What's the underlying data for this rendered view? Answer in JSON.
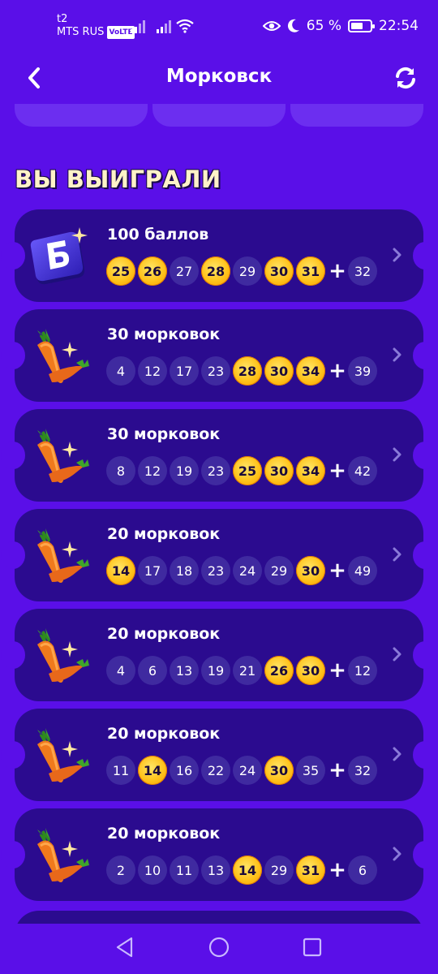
{
  "status_bar": {
    "operator_line1": "t2",
    "operator_line2": "MTS RUS",
    "volte": "VoLTE",
    "battery": "65 %",
    "battery_level": 0.65,
    "time": "22:54"
  },
  "header": {
    "title": "Морковск",
    "back_icon": "chevron-left-icon",
    "refresh_icon": "refresh-icon"
  },
  "section_title": "ВЫ ВЫИГРАЛИ",
  "cards": [
    {
      "prize": "100 баллов",
      "icon": "b-logo-icon",
      "numbers": [
        "25",
        "26",
        "27",
        "28",
        "29",
        "30",
        "31"
      ],
      "wins": [
        true,
        true,
        false,
        true,
        false,
        true,
        true
      ],
      "bonus": "32",
      "bonus_win": false
    },
    {
      "prize": "30 морковок",
      "icon": "carrot-icon",
      "numbers": [
        "4",
        "12",
        "17",
        "23",
        "28",
        "30",
        "34"
      ],
      "wins": [
        false,
        false,
        false,
        false,
        true,
        true,
        true
      ],
      "bonus": "39",
      "bonus_win": false
    },
    {
      "prize": "30 морковок",
      "icon": "carrot-icon",
      "numbers": [
        "8",
        "12",
        "19",
        "23",
        "25",
        "30",
        "34"
      ],
      "wins": [
        false,
        false,
        false,
        false,
        true,
        true,
        true
      ],
      "bonus": "42",
      "bonus_win": false
    },
    {
      "prize": "20 морковок",
      "icon": "carrot-icon",
      "numbers": [
        "14",
        "17",
        "18",
        "23",
        "24",
        "29",
        "30"
      ],
      "wins": [
        true,
        false,
        false,
        false,
        false,
        false,
        true
      ],
      "bonus": "49",
      "bonus_win": false
    },
    {
      "prize": "20 морковок",
      "icon": "carrot-icon",
      "numbers": [
        "4",
        "6",
        "13",
        "19",
        "21",
        "26",
        "30"
      ],
      "wins": [
        false,
        false,
        false,
        false,
        false,
        true,
        true
      ],
      "bonus": "12",
      "bonus_win": false
    },
    {
      "prize": "20 морковок",
      "icon": "carrot-icon",
      "numbers": [
        "11",
        "14",
        "16",
        "22",
        "24",
        "30",
        "35"
      ],
      "wins": [
        false,
        true,
        false,
        false,
        false,
        true,
        false
      ],
      "bonus": "32",
      "bonus_win": false
    },
    {
      "prize": "20 морковок",
      "icon": "carrot-icon",
      "numbers": [
        "2",
        "10",
        "11",
        "13",
        "14",
        "29",
        "31"
      ],
      "wins": [
        false,
        false,
        false,
        false,
        true,
        false,
        true
      ],
      "bonus": "6",
      "bonus_win": false
    }
  ],
  "colors": {
    "background": "#5a0fe8",
    "card": "#2b0b8f",
    "ball": "#3f2aa0",
    "ball_win": "#ffc21a",
    "section_title": "#fff2c8"
  },
  "nav": [
    "back-triangle-icon",
    "home-circle-icon",
    "recents-square-icon"
  ]
}
